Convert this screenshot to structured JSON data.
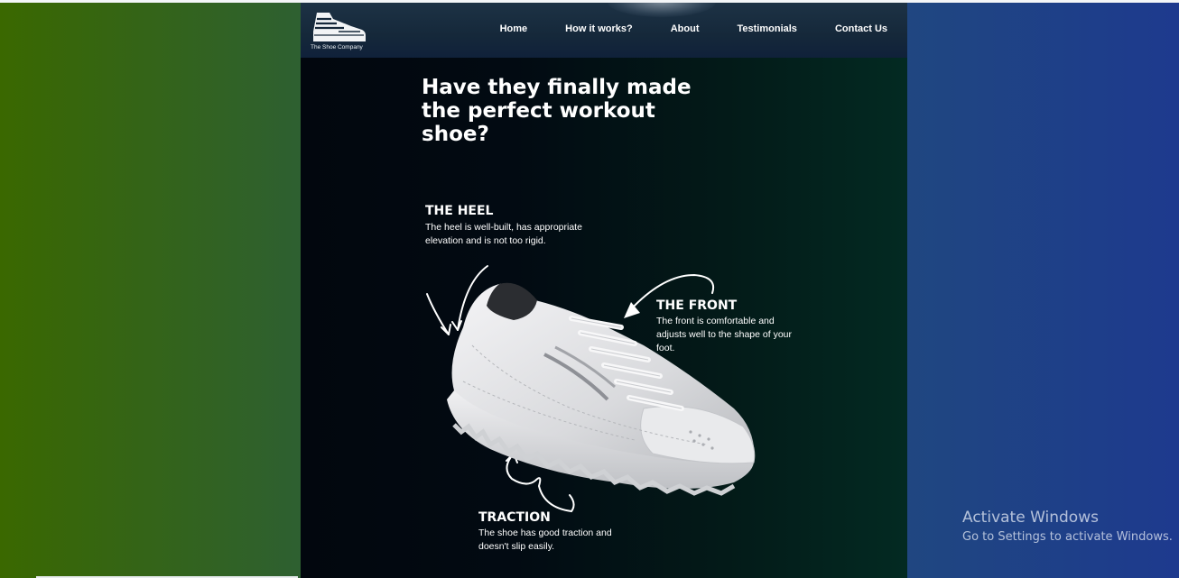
{
  "brand": {
    "logo_text": "The Shoe Company",
    "logo_icon": "sneaker-icon"
  },
  "nav": {
    "links": [
      "Home",
      "How it works?",
      "About",
      "Testimonials",
      "Contact Us"
    ]
  },
  "hero": {
    "headline": "Have they finally made the perfect workout shoe?"
  },
  "callouts": {
    "heel": {
      "title": "THE HEEL",
      "text": "The heel is well-built, has appropriate elevation and is not too rigid."
    },
    "front": {
      "title": "THE FRONT",
      "text": "The front is comfortable and adjusts well to the shape of your foot."
    },
    "traction": {
      "title": "TRACTION",
      "text": "The shoe has good traction and doesn't slip easily."
    }
  },
  "watermark": {
    "title": "Activate Windows",
    "subtitle": "Go to Settings to activate Windows."
  },
  "colors": {
    "accent_text": "#ffffff",
    "page_bg": "#02070e"
  }
}
